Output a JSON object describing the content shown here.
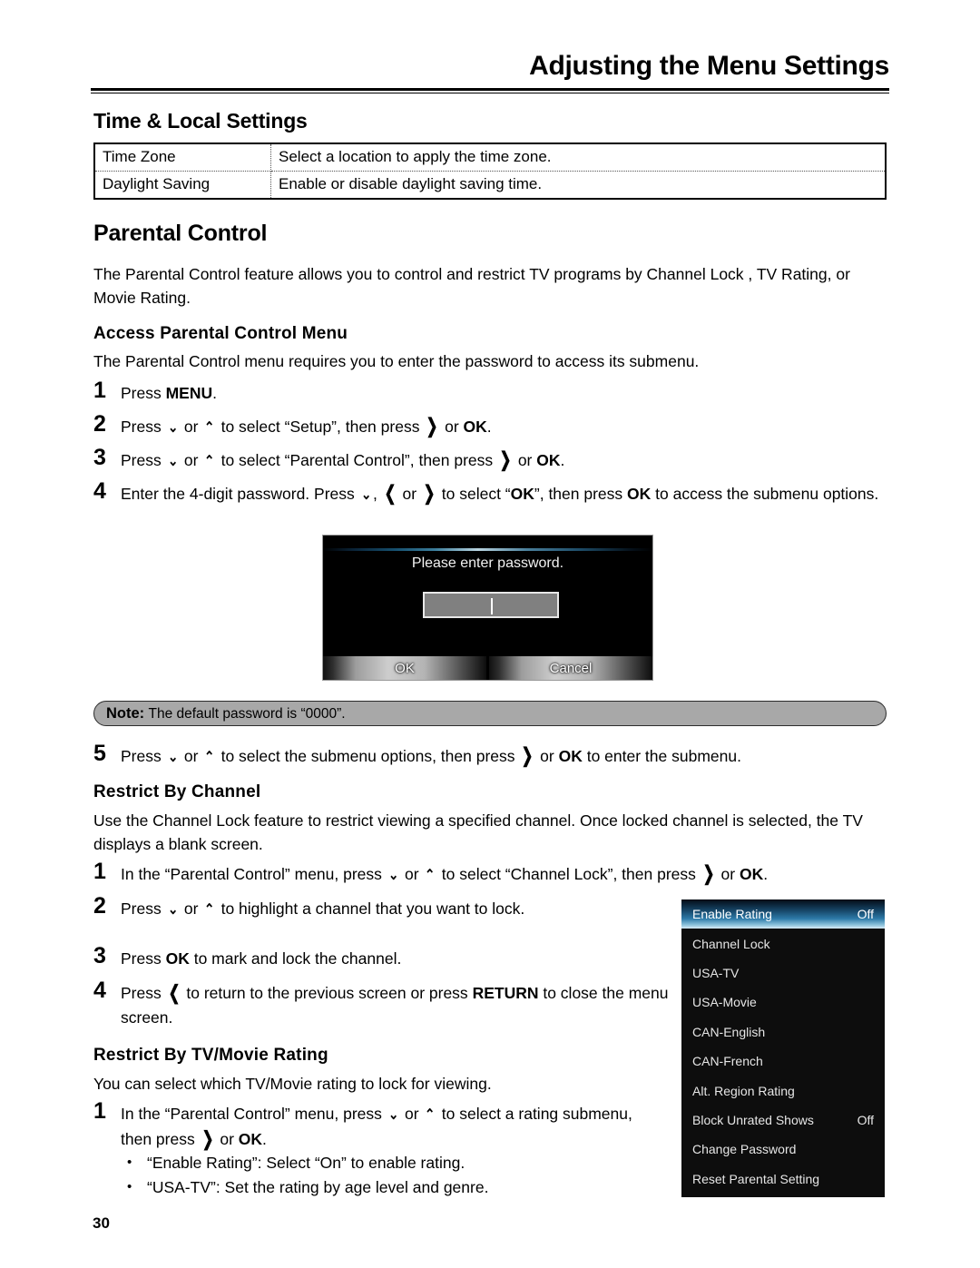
{
  "header": {
    "title": "Adjusting the Menu Settings"
  },
  "time_local": {
    "heading": "Time & Local Settings",
    "rows": [
      {
        "label": "Time Zone",
        "description": "Select a location to apply the time zone."
      },
      {
        "label": "Daylight Saving",
        "description": "Enable or disable daylight saving time."
      }
    ]
  },
  "parental": {
    "heading": "Parental Control",
    "intro": "The Parental Control feature allows you to control and restrict TV programs by Channel Lock , TV Rating, or Movie Rating.",
    "access_heading": "Access Parental Control Menu",
    "access_intro": "The Parental Control menu requires you to enter the password to access its submenu.",
    "steps": [
      {
        "num": "1",
        "pre": "Press ",
        "bold1": "MENU",
        "post": "."
      },
      {
        "num": "2",
        "text_a": "Press ",
        "g1": "⌄",
        "text_b": " or ",
        "g2": "⌃",
        "text_c": " to select “Setup”, then press ",
        "g3": "❯",
        "text_d": " or ",
        "bold": "OK",
        "text_e": "."
      },
      {
        "num": "3",
        "text_a": "Press ",
        "g1": "⌄",
        "text_b": " or ",
        "g2": "⌃",
        "text_c": " to select “Parental Control”, then press ",
        "g3": "❯",
        "text_d": " or ",
        "bold": "OK",
        "text_e": "."
      },
      {
        "num": "4",
        "text_a": "Enter the 4-digit password. Press ",
        "g1": "⌄",
        "text_b": ", ",
        "g2": "❮",
        "text_c": " or ",
        "g3": "❯",
        "text_d": " to select “",
        "bold1": "OK",
        "text_e": "”, then press ",
        "bold2": "OK",
        "text_f": " to access the submenu options."
      }
    ],
    "step5": {
      "num": "5",
      "text_a": "Press ",
      "g1": "⌄",
      "text_b": " or ",
      "g2": "⌃",
      "text_c": " to select the submenu options, then press ",
      "g3": "❯",
      "text_d": " or ",
      "bold": "OK",
      "text_e": " to enter the submenu."
    }
  },
  "note": {
    "label": "Note:",
    "text": "The default password is “0000”."
  },
  "password_dialog": {
    "prompt": "Please enter password.",
    "input_value": "",
    "ok_label": "OK",
    "cancel_label": "Cancel"
  },
  "restrict_channel": {
    "heading": "Restrict By Channel",
    "intro": "Use the Channel Lock feature to restrict viewing a specified channel. Once locked channel is selected, the TV displays a blank screen.",
    "steps": [
      {
        "num": "1",
        "text_a": "In the “Parental Control” menu, press ",
        "g1": "⌄",
        "text_b": " or ",
        "g2": "⌃",
        "text_c": " to select “Channel Lock”, then press ",
        "g3": "❯",
        "text_d": " or ",
        "bold": "OK",
        "text_e": "."
      },
      {
        "num": "2",
        "text_a": "Press ",
        "g1": "⌄",
        "text_b": " or ",
        "g2": "⌃",
        "text_c": " to highlight a channel that you want to lock."
      },
      {
        "num": "3",
        "text_a": "Press ",
        "bold": "OK",
        "text_b": " to mark and lock the channel."
      },
      {
        "num": "4",
        "text_a": "Press ",
        "g1": "❮",
        "text_b": " to return to the previous screen or press ",
        "bold": "RETURN",
        "text_c": " to close the menu screen."
      }
    ]
  },
  "restrict_rating": {
    "heading": "Restrict By TV/Movie Rating",
    "intro": "You can select which TV/Movie rating to lock for viewing.",
    "step1": {
      "num": "1",
      "text_a": "In the “Parental Control” menu, press ",
      "g1": "⌄",
      "text_b": " or ",
      "g2": "⌃",
      "text_c": " to select a rating submenu, then press ",
      "g3": "❯",
      "text_d": " or ",
      "bold": "OK",
      "text_e": "."
    },
    "bullets": [
      "“Enable Rating”: Select “On” to enable rating.",
      "“USA-TV”: Set the rating by age level and genre."
    ]
  },
  "tv_menu": {
    "items": [
      {
        "label": "Enable Rating",
        "value": "Off",
        "selected": true
      },
      {
        "label": "Channel Lock",
        "value": "",
        "selected": false
      },
      {
        "label": "USA-TV",
        "value": "",
        "selected": false
      },
      {
        "label": "USA-Movie",
        "value": "",
        "selected": false
      },
      {
        "label": "CAN-English",
        "value": "",
        "selected": false
      },
      {
        "label": "CAN-French",
        "value": "",
        "selected": false
      },
      {
        "label": "Alt. Region Rating",
        "value": "",
        "selected": false
      },
      {
        "label": "Block Unrated Shows",
        "value": "Off",
        "selected": false
      },
      {
        "label": "Change Password",
        "value": "",
        "selected": false
      },
      {
        "label": "Reset Parental Setting",
        "value": "",
        "selected": false
      }
    ]
  },
  "footer": {
    "page_number": "30"
  }
}
